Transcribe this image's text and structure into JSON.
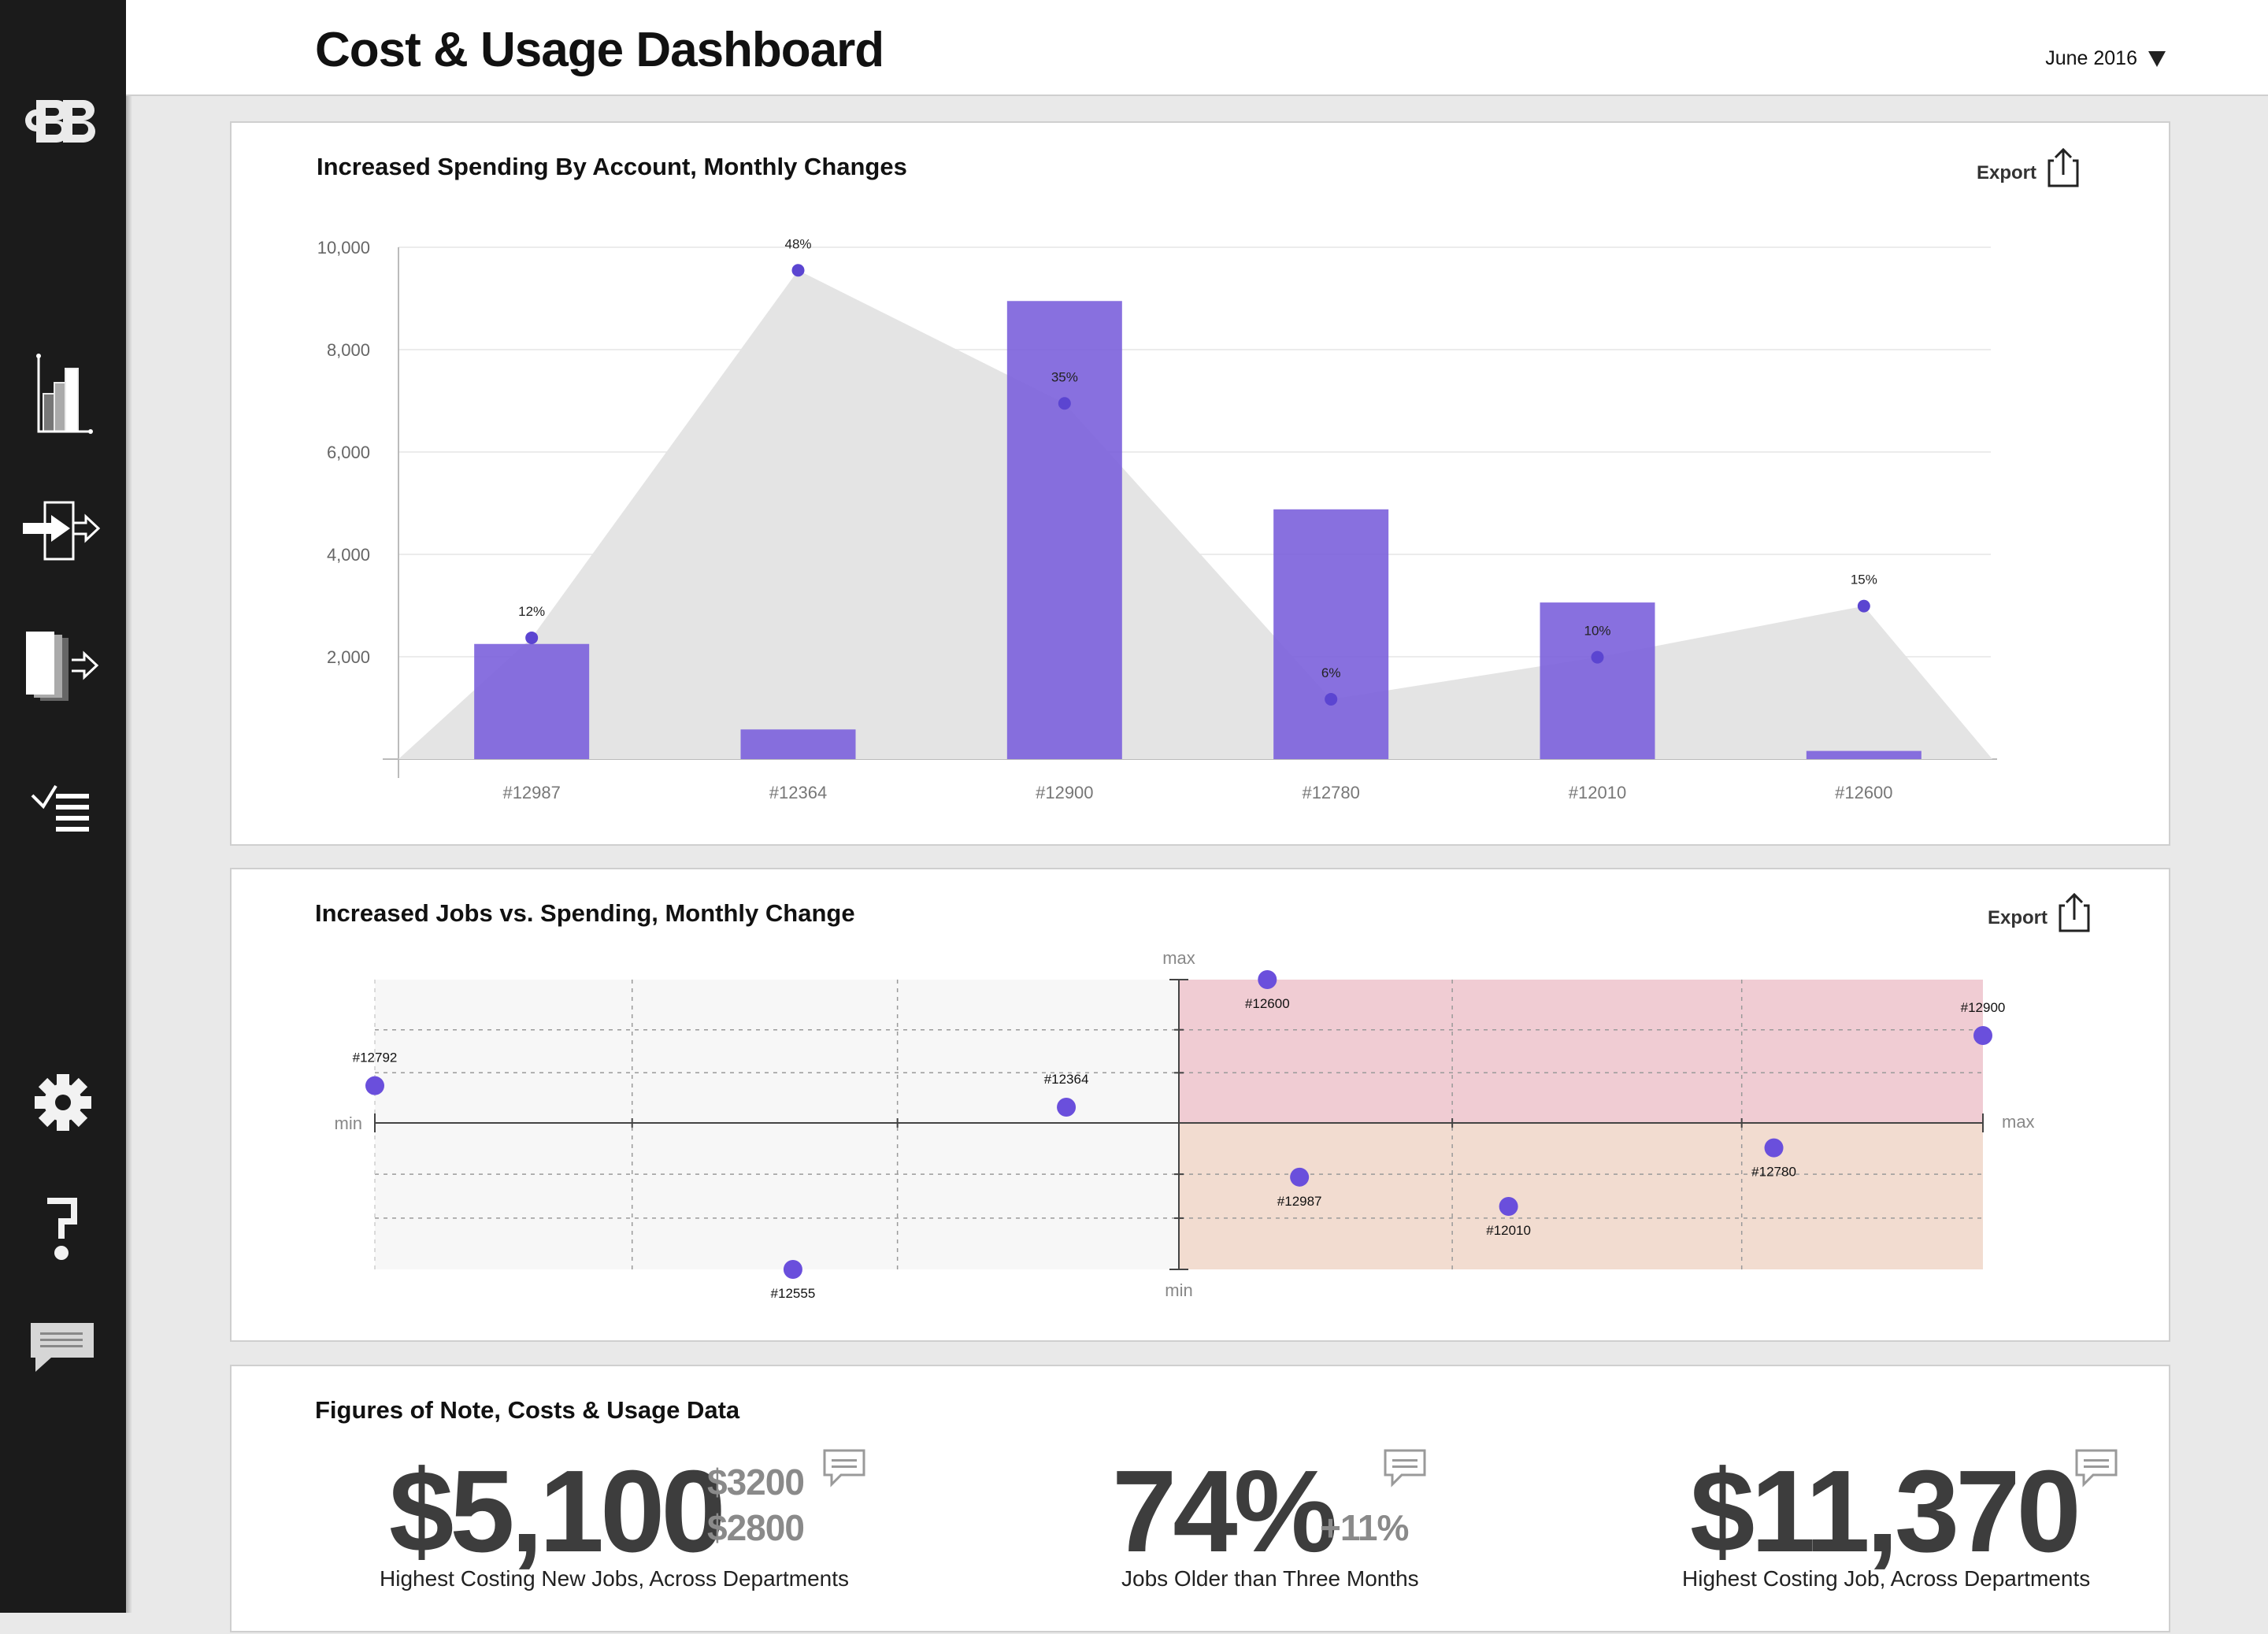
{
  "app": {
    "title": "Cost & Usage Dashboard",
    "month": "June 2016"
  },
  "sidebar": {
    "items": [
      {
        "icon": "logo-icon"
      },
      {
        "icon": "bar-chart-icon"
      },
      {
        "icon": "import-icon"
      },
      {
        "icon": "documents-export-icon"
      },
      {
        "icon": "checklist-icon"
      },
      {
        "icon": "gear-icon"
      },
      {
        "icon": "help-icon"
      },
      {
        "icon": "chat-icon"
      }
    ]
  },
  "export_label": "Export",
  "panels": {
    "spending": {
      "title": "Increased Spending By Account, Monthly Changes"
    },
    "jobs": {
      "title": "Increased Jobs vs. Spending, Monthly Change",
      "labels": {
        "x_min": "min",
        "x_max": "max",
        "y_min": "min",
        "y_max": "max"
      }
    },
    "figures": {
      "title": "Figures of Note, Costs & Usage Data",
      "metrics": [
        {
          "value": "$5,100",
          "sub1": "$3200",
          "sub2": "$2800",
          "caption": "Highest Costing New Jobs, Across Departments"
        },
        {
          "value": "74%",
          "sub1": "+11%",
          "caption": "Jobs Older than Three Months"
        },
        {
          "value": "$11,370",
          "caption": "Highest Costing Job, Across Departments"
        }
      ]
    }
  },
  "chart_data": [
    {
      "type": "bar",
      "title": "Increased Spending By Account, Monthly Changes",
      "categories": [
        "#12987",
        "#12364",
        "#12900",
        "#12780",
        "#12010",
        "#12600"
      ],
      "y_ticks": [
        "10,000",
        "8,000",
        "6,000",
        "4,000",
        "2,000"
      ],
      "ylim": [
        0,
        10000
      ],
      "series": [
        {
          "type": "bar",
          "values": [
            2250,
            580,
            8950,
            4880,
            3060,
            160
          ],
          "color": "#7b61db"
        },
        {
          "type": "area",
          "values": [
            2370,
            9550,
            6950,
            1170,
            1990,
            2990
          ],
          "point_labels": [
            "12%",
            "48%",
            "35%",
            "6%",
            "10%",
            "15%"
          ],
          "color": "#e4e4e4",
          "point_color": "#5b45d1"
        }
      ],
      "grid": true
    },
    {
      "type": "scatter",
      "title": "Increased Jobs vs. Spending, Monthly Change",
      "quadrant_colors": {
        "upper_right": "#f0ccd3",
        "lower_right": "#f2dcd0",
        "left": "#f7f7f7"
      },
      "point_color": "#6a4fdc",
      "xlim": [
        -1,
        1
      ],
      "ylim": [
        -1,
        1
      ],
      "points": [
        {
          "label": "#12792",
          "x": -1.0,
          "y": 0.26
        },
        {
          "label": "#12364",
          "x": -0.14,
          "y": 0.11
        },
        {
          "label": "#12555",
          "x": -0.48,
          "y": -1.0
        },
        {
          "label": "#12600",
          "x": 0.11,
          "y": 1.0
        },
        {
          "label": "#12900",
          "x": 1.0,
          "y": 0.61
        },
        {
          "label": "#12987",
          "x": 0.15,
          "y": -0.37
        },
        {
          "label": "#12010",
          "x": 0.41,
          "y": -0.57
        },
        {
          "label": "#12780",
          "x": 0.74,
          "y": -0.17
        }
      ]
    }
  ]
}
